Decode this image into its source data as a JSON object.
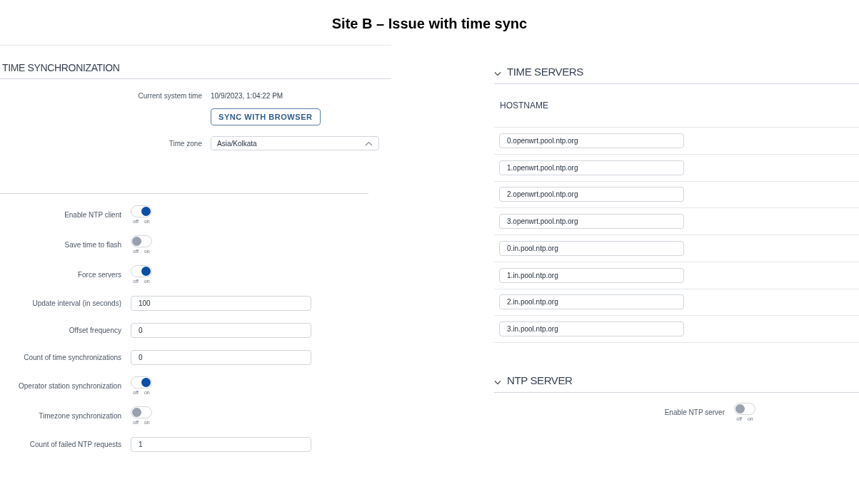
{
  "title": "Site B – Issue with time sync",
  "time_sync": {
    "heading": "TIME SYNCHRONIZATION",
    "current_time": {
      "label": "Current system time",
      "value": "10/9/2023, 1:04:22 PM"
    },
    "sync_button": "SYNC WITH BROWSER",
    "time_zone": {
      "label": "Time zone",
      "value": "Asia/Kolkata",
      "expanded": true
    },
    "fields": [
      {
        "kind": "toggle",
        "label": "Enable NTP client",
        "on": true,
        "off_label": "off",
        "on_label": "on"
      },
      {
        "kind": "toggle",
        "label": "Save time to flash",
        "on": false,
        "off_label": "off",
        "on_label": "on"
      },
      {
        "kind": "toggle",
        "label": "Force servers",
        "on": true,
        "off_label": "off",
        "on_label": "on"
      },
      {
        "kind": "input",
        "label": "Update interval (in seconds)",
        "value": "100"
      },
      {
        "kind": "input",
        "label": "Offset frequency",
        "value": "0"
      },
      {
        "kind": "input",
        "label": "Count of time synchronizations",
        "value": "0"
      },
      {
        "kind": "toggle",
        "label": "Operator station synchronization",
        "on": true,
        "off_label": "off",
        "on_label": "on"
      },
      {
        "kind": "toggle",
        "label": "Timezone synchronization",
        "on": false,
        "off_label": "off",
        "on_label": "on"
      },
      {
        "kind": "input",
        "label": "Count of failed NTP requests",
        "value": "1"
      }
    ]
  },
  "time_servers": {
    "heading": "TIME SERVERS",
    "expanded": true,
    "column": "HOSTNAME",
    "rows": [
      "0.openwrt.pool.ntp.org",
      "1.openwrt.pool.ntp.org",
      "2.openwrt.pool.ntp.org",
      "3.openwrt.pool.ntp.org",
      "0.in.pool.ntp.org",
      "1.in.pool.ntp.org",
      "2.in.pool.ntp.org",
      "3.in.pool.ntp.org"
    ]
  },
  "ntp_server": {
    "heading": "NTP SERVER",
    "expanded": true,
    "enable": {
      "label": "Enable NTP server",
      "on": false,
      "off_label": "off",
      "on_label": "on"
    }
  }
}
